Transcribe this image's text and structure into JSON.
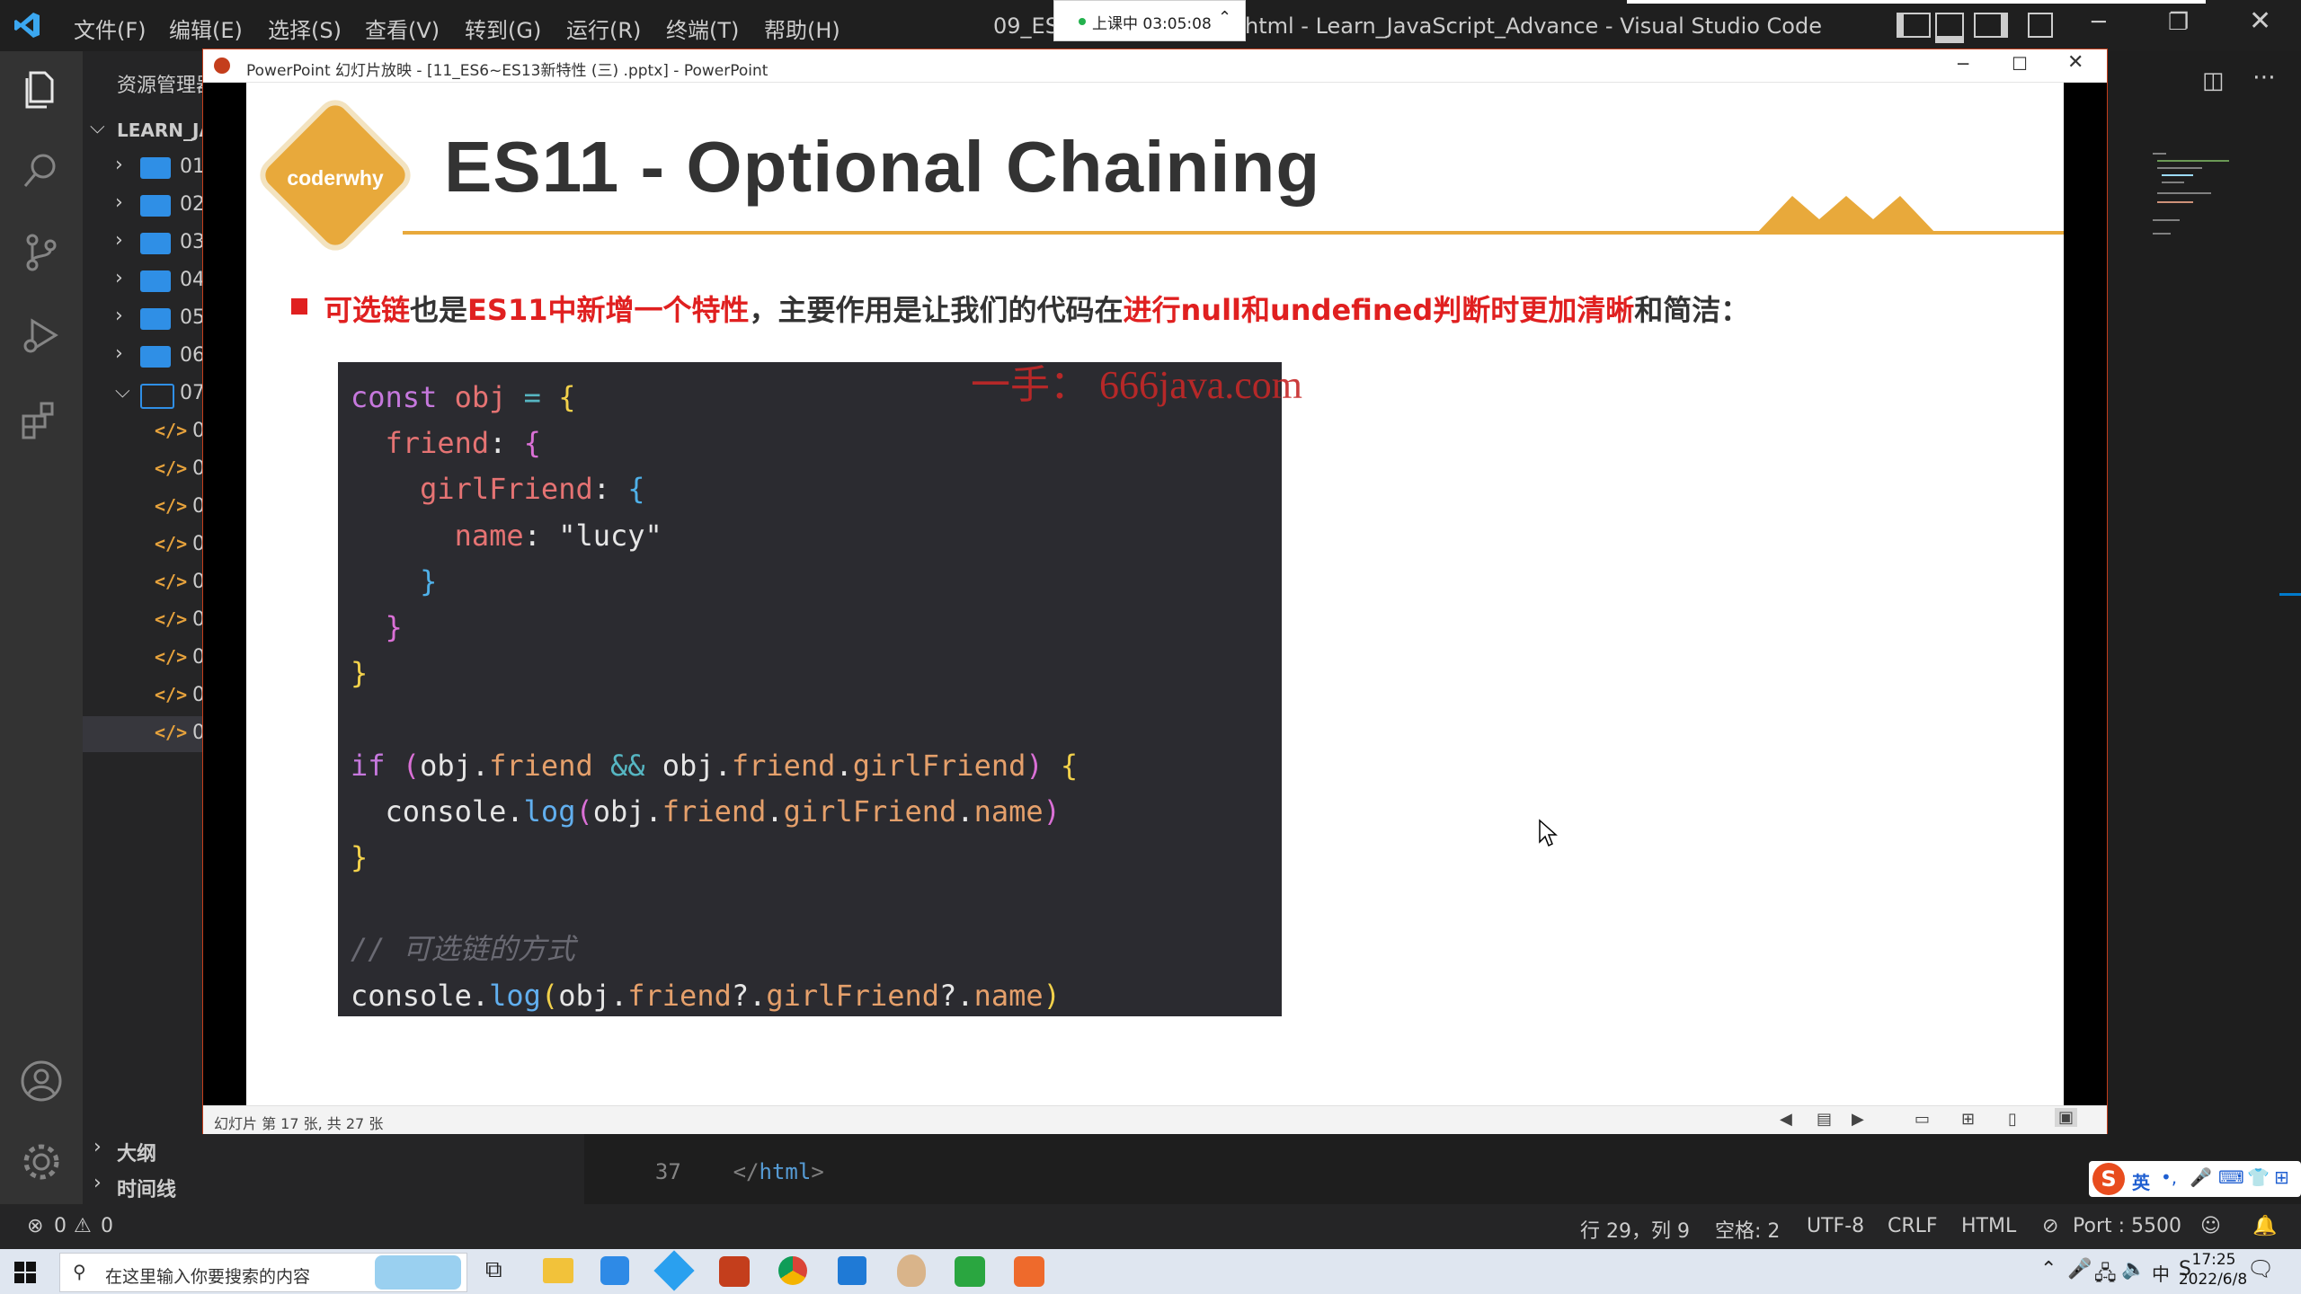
{
  "vscode": {
    "menu": [
      "文件(F)",
      "编辑(E)",
      "选择(S)",
      "查看(V)",
      "转到(G)",
      "运行(R)",
      "终端(T)",
      "帮助(H)"
    ],
    "title_left": "09_ES1",
    "title": "html - Learn_JavaScript_Advance - Visual Studio Code",
    "explorer_label": "资源管理器",
    "workspace": "LEARN_JA",
    "folders": [
      "01",
      "02",
      "03",
      "04",
      "05",
      "06",
      "07"
    ],
    "files": [
      "0",
      "0",
      "0",
      "0",
      "0",
      "0",
      "0",
      "0",
      "0"
    ],
    "outline": [
      "大纲",
      "时间线"
    ],
    "editor_line_no": "37",
    "editor_line_text": "</html>"
  },
  "recording": {
    "label": "上课中 03:05:08"
  },
  "powerpoint": {
    "title": "PowerPoint 幻灯片放映 - [11_ES6~ES13新特性 (三) .pptx] - PowerPoint",
    "status": "幻灯片 第 17 张, 共 27 张"
  },
  "slide": {
    "logo": "coderwhy",
    "title": "ES11 - Optional Chaining",
    "bullet": {
      "p1": "可选链",
      "p2": "也是",
      "p3": "ES11中新增一个特性",
      "p4": "，主要作用是让我们的代码在",
      "p5": "进行null和undefined判断时更加清晰",
      "p6": "和简洁："
    },
    "watermark": "一手： 666java.com",
    "code": [
      "const obj = {",
      "  friend: {",
      "    girlFriend: {",
      "      name: \"lucy\"",
      "    }",
      "  }",
      "}",
      "",
      "if (obj.friend && obj.friend.girlFriend) {",
      "  console.log(obj.friend.girlFriend.name)",
      "}",
      "",
      "// 可选链的方式",
      "console.log(obj.friend?.girlFriend?.name)"
    ]
  },
  "statusbar": {
    "problems": "0",
    "warnings": "0",
    "position": "行 29，列 9",
    "spaces": "空格: 2",
    "encoding": "UTF-8",
    "eol": "CRLF",
    "language": "HTML",
    "port": "Port : 5500"
  },
  "taskbar": {
    "search_placeholder": "在这里输入你要搜索的内容",
    "time": "17:25",
    "date": "2022/6/8"
  }
}
